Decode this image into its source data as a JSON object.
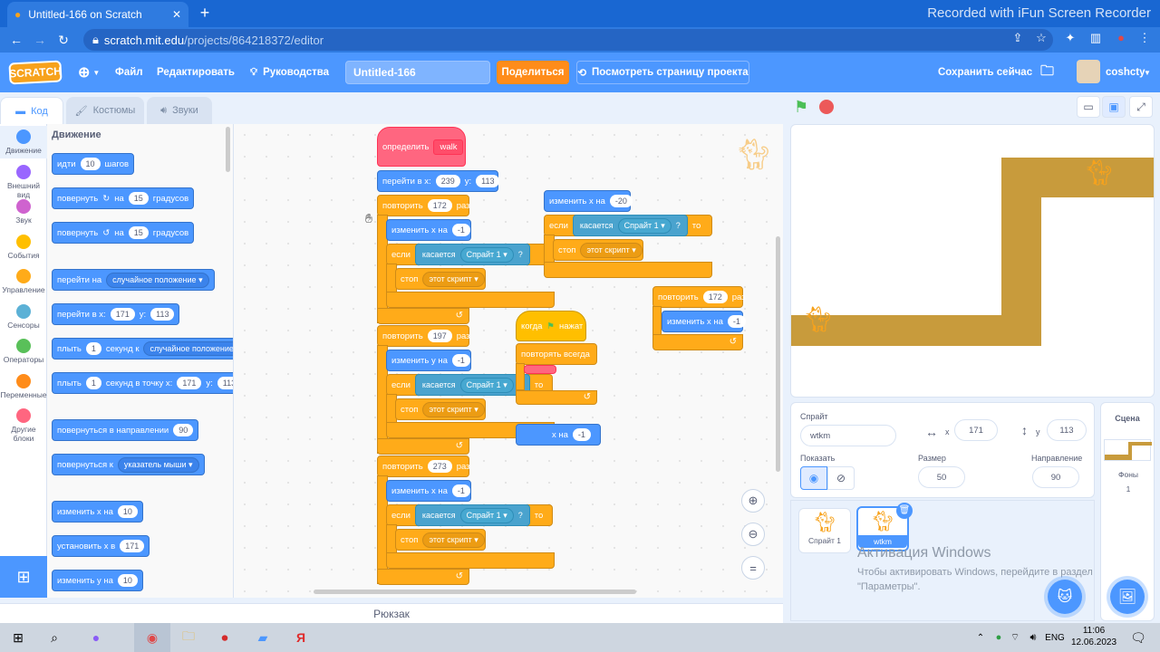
{
  "browser": {
    "tab_title": "Untitled-166 on Scratch",
    "tab_close": "✕",
    "new_tab": "+",
    "recorder_watermark": "Recorded with iFun Screen Recorder",
    "url_host": "scratch.mit.edu",
    "url_path": "/projects/864218372/editor"
  },
  "menubar": {
    "logo": "SCRATCH",
    "file": "Файл",
    "edit": "Редактировать",
    "tutorials": "Руководства",
    "project_title": "Untitled-166",
    "share": "Поделиться",
    "see_project": "Посмотреть страницу проекта",
    "save_now": "Сохранить сейчас",
    "username": "coshcty"
  },
  "tabs": {
    "code": "Код",
    "costumes": "Костюмы",
    "sounds": "Звуки"
  },
  "categories": [
    {
      "label": "Движение",
      "color": "#4c97ff"
    },
    {
      "label": "Внешний вид",
      "color": "#9966ff"
    },
    {
      "label": "Звук",
      "color": "#cf63cf"
    },
    {
      "label": "События",
      "color": "#ffbf00"
    },
    {
      "label": "Управление",
      "color": "#ffab19"
    },
    {
      "label": "Сенсоры",
      "color": "#5cb1d6"
    },
    {
      "label": "Операторы",
      "color": "#59c059"
    },
    {
      "label": "Переменные",
      "color": "#ff8c1a"
    },
    {
      "label": "Другие блоки",
      "color": "#ff6680"
    }
  ],
  "palette": {
    "heading": "Движение",
    "move": {
      "a": "идти",
      "n": "10",
      "b": "шагов"
    },
    "turn_right": {
      "a": "повернуть",
      "b": "на",
      "n": "15",
      "c": "градусов"
    },
    "turn_left": {
      "a": "повернуть",
      "b": "на",
      "n": "15",
      "c": "градусов"
    },
    "goto": {
      "a": "перейти на",
      "dd": "случайное положение"
    },
    "goto_xy": {
      "a": "перейти в x:",
      "x": "171",
      "b": "y:",
      "y": "113"
    },
    "glide": {
      "a": "плыть",
      "n": "1",
      "b": "секунд к",
      "dd": "случайное положение"
    },
    "glide_xy": {
      "a": "плыть",
      "n": "1",
      "b": "секунд в точку x:",
      "x": "171",
      "c": "y:",
      "y": "113"
    },
    "point_dir": {
      "a": "повернуться в направлении",
      "n": "90"
    },
    "point_towards": {
      "a": "повернуться к",
      "dd": "указатель мыши"
    },
    "change_x": {
      "a": "изменить x на",
      "n": "10"
    },
    "set_x": {
      "a": "установить x в",
      "n": "171"
    },
    "change_y": {
      "a": "изменить у на",
      "n": "10"
    }
  },
  "script": {
    "define": "определить",
    "define_name": "walk",
    "goto_a": "перейти в x:",
    "goto_x": "239",
    "goto_b": "у:",
    "goto_y": "113",
    "repeat": "повторить",
    "times": "раз",
    "r1": "172",
    "r2": "197",
    "r3": "273",
    "change_x": "изменить х на",
    "change_y": "изменить у на",
    "neg1": "-1",
    "if": "если",
    "touching": "касается",
    "sprite1": "Спрайт 1",
    "q": "?",
    "then": "то",
    "stop": "стоп",
    "this_script": "этот скрипт",
    "right_change": "изменить х на",
    "right_n": "-20",
    "repeat2_n": "172",
    "when": "когда",
    "flag_clicked": "нажат",
    "forever": "повторять всегда",
    "hidden_tail": "х на",
    "hidden_n": "-1"
  },
  "backpack": "Рюкзак",
  "sprite": {
    "label": "Спрайт",
    "name": "wtkm",
    "x_label": "x",
    "x": "171",
    "y_label": "y",
    "y": "113",
    "show_label": "Показать",
    "size_label": "Размер",
    "size": "50",
    "dir_label": "Направление",
    "dir": "90"
  },
  "sprites": [
    {
      "name": "Спрайт 1"
    },
    {
      "name": "wtkm"
    }
  ],
  "stage_pane": {
    "title": "Сцена",
    "backdrops_label": "Фоны",
    "backdrops_count": "1"
  },
  "windows": {
    "activate_title": "Активация Windows",
    "activate_text": "Чтобы активировать Windows, перейдите в раздел \"Параметры\".",
    "lang": "ENG",
    "time": "11:06",
    "date": "12.06.2023"
  }
}
